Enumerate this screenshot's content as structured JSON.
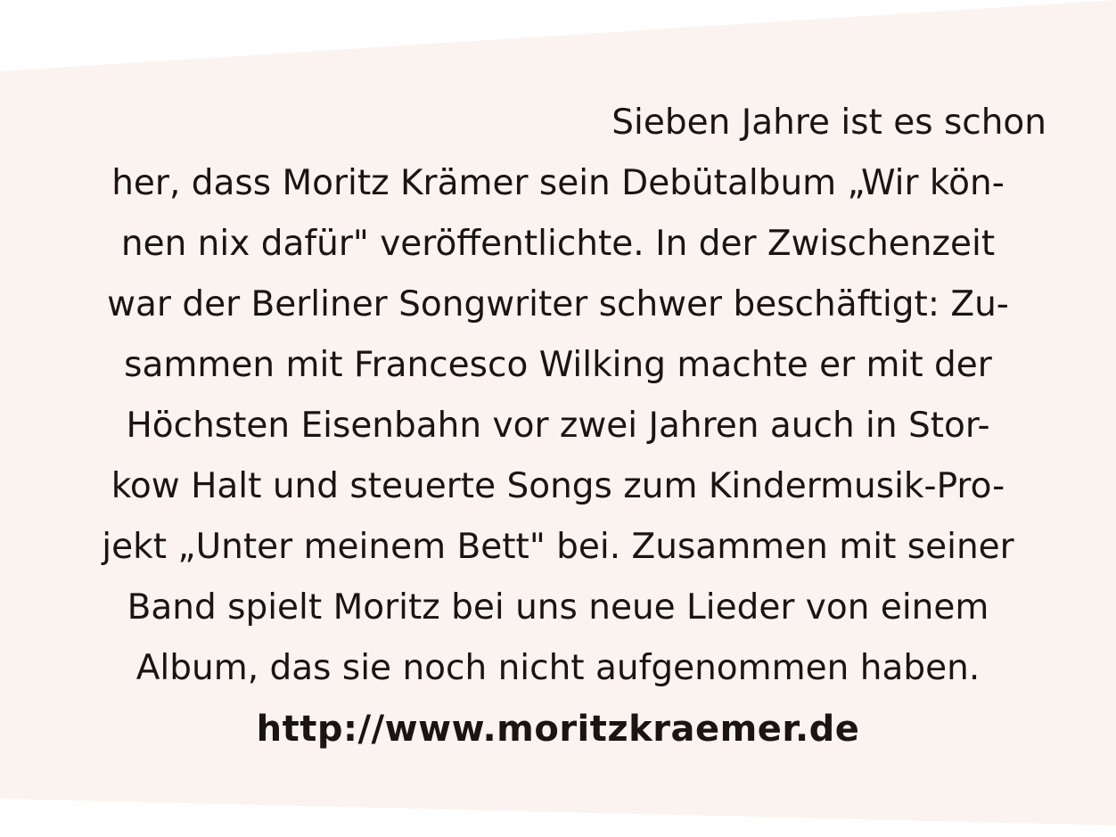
{
  "article": {
    "lines": [
      "Sieben Jahre ist es schon",
      "her, dass Moritz Krämer sein Debütalbum „Wir kön-",
      "nen nix dafür\" veröffentlichte. In der Zwischenzeit",
      "war der Berliner Songwriter schwer beschäftigt: Zu-",
      "sammen mit Francesco Wilking machte er mit der",
      "Höchsten Eisenbahn vor zwei Jahren auch in Stor-",
      "kow Halt und steuerte Songs zum Kindermusik-Pro-",
      "jekt „Unter meinem Bett\" bei. Zusammen mit seiner",
      "Band spielt Moritz bei uns neue Lieder von einem",
      "Album, das sie noch nicht aufgenommen haben."
    ],
    "link": "http://www.moritzkraemer.de"
  },
  "colors": {
    "background": "#fbf3ef",
    "text": "#1a1414"
  }
}
